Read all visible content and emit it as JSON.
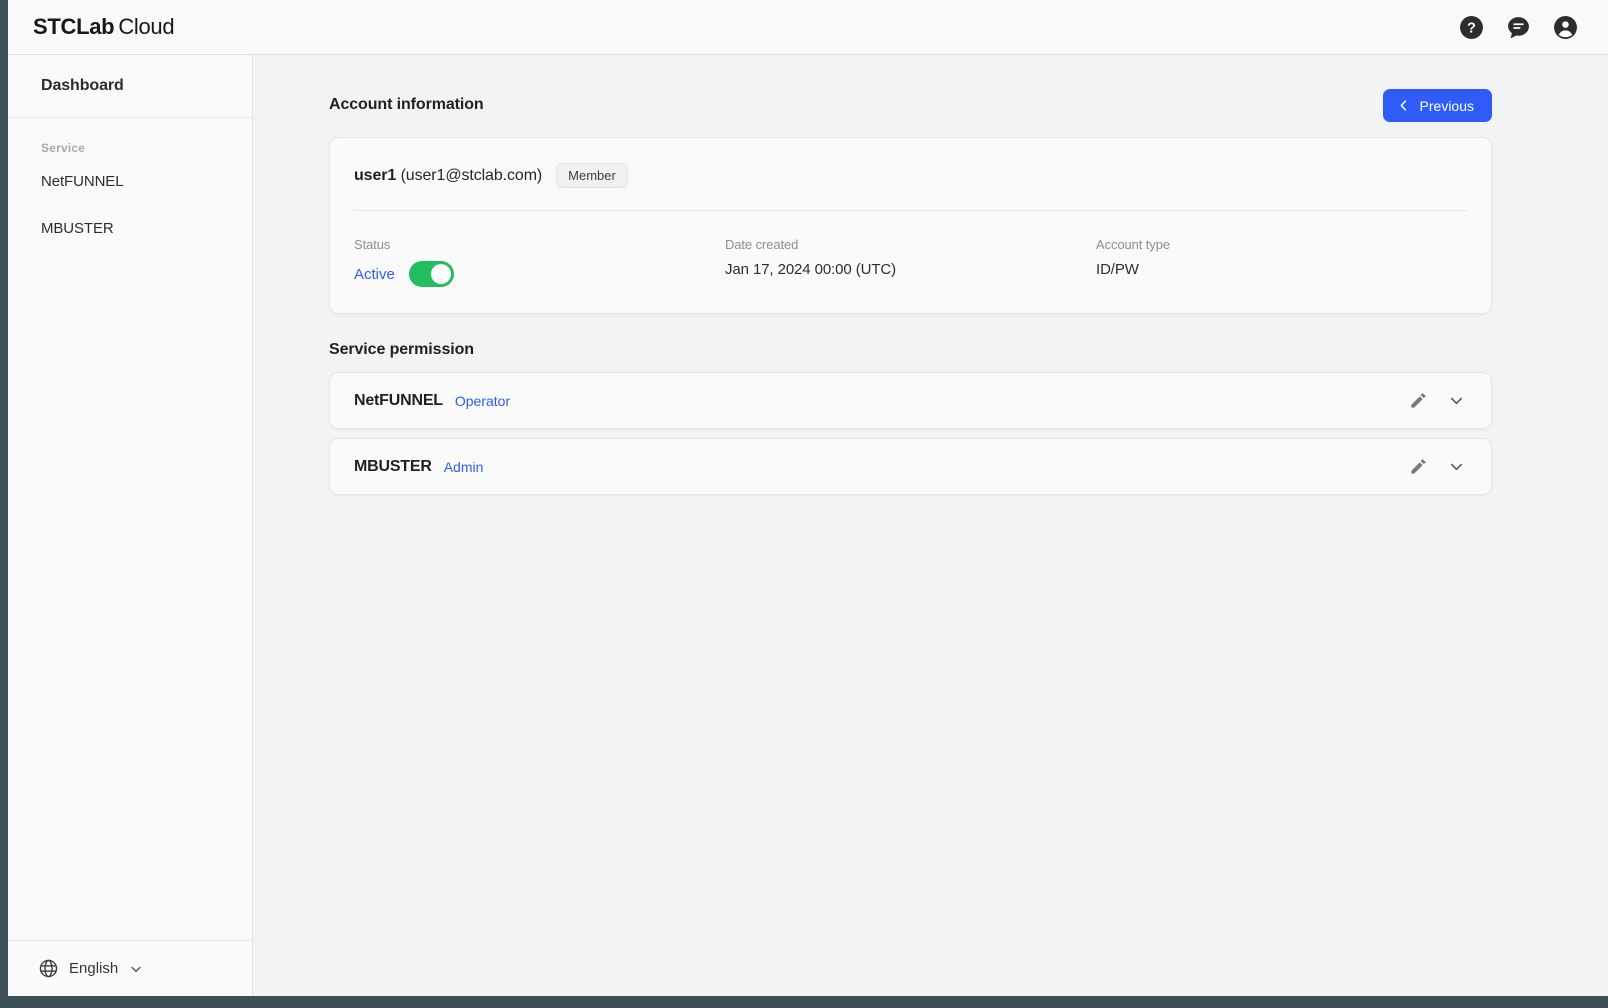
{
  "header": {
    "logo_brand": "STCLab",
    "logo_suffix": "Cloud",
    "icons": [
      "help-icon",
      "chat-icon",
      "account-icon"
    ]
  },
  "sidebar": {
    "dashboard_label": "Dashboard",
    "section_label": "Service",
    "items": [
      {
        "label": "NetFUNNEL"
      },
      {
        "label": "MBUSTER"
      }
    ],
    "language": {
      "label": "English",
      "icon": "globe-icon",
      "chevron": "chevron-down-icon"
    }
  },
  "main": {
    "account_section_title": "Account information",
    "previous_button": "Previous",
    "account": {
      "username": "user1",
      "email": "(user1@stclab.com)",
      "role_badge": "Member",
      "fields": {
        "status_label": "Status",
        "status_value": "Active",
        "date_label": "Date created",
        "date_value": "Jan 17, 2024 00:00 (UTC)",
        "type_label": "Account type",
        "type_value": "ID/PW"
      }
    },
    "permission_section_title": "Service permission",
    "permissions": [
      {
        "service": "NetFUNNEL",
        "role": "Operator"
      },
      {
        "service": "MBUSTER",
        "role": "Admin"
      }
    ]
  },
  "colors": {
    "accent_blue": "#2f5cf6",
    "toggle_green": "#22bd5e",
    "page_bg": "#f2f3f5",
    "card_bg": "#fafafb"
  }
}
